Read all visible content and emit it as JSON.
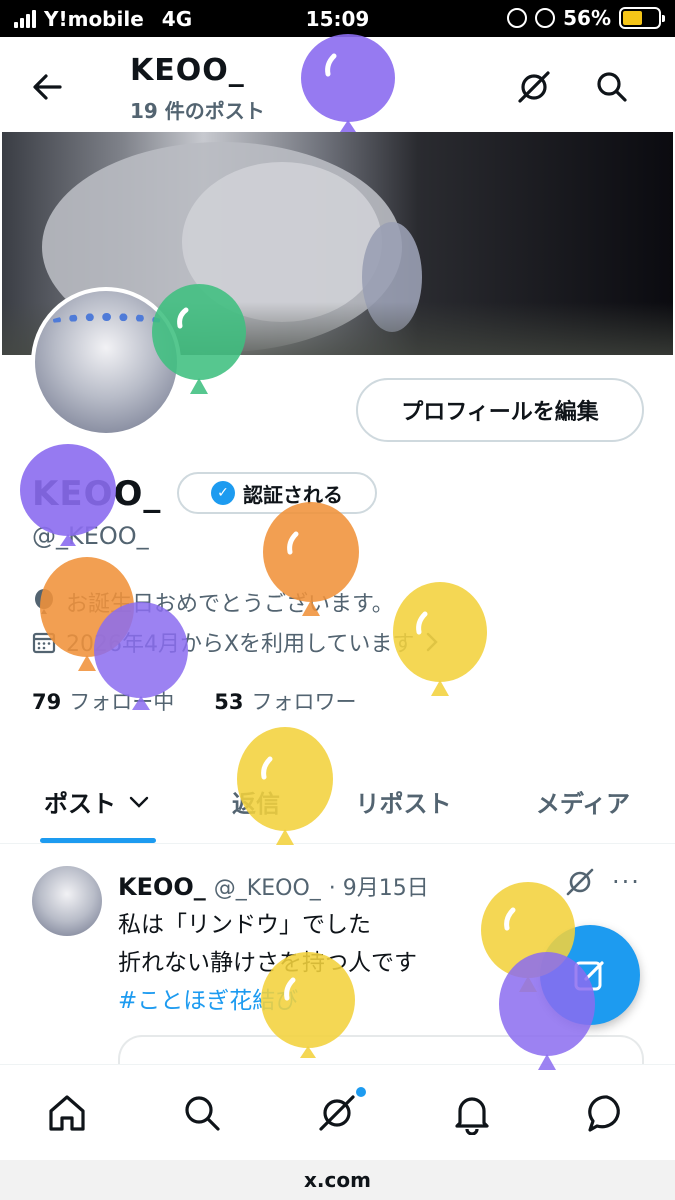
{
  "status_bar": {
    "carrier": "Y!mobile",
    "network": "4G",
    "time": "15:09",
    "battery": "56%",
    "battery_level": 0.56
  },
  "header": {
    "name": "KEOO_",
    "post_count": "19 件のポスト",
    "back_icon": "arrow-left-icon",
    "grok_icon": "grok-icon",
    "search_icon": "search-icon"
  },
  "profile": {
    "edit_button": "プロフィールを編集",
    "name": "KEOO_",
    "verify_button": "認証される",
    "handle": "@_KEOO_",
    "birthday_text": "お誕生日おめでとうございます。",
    "joined_text": "2026年4月からXを利用しています",
    "following_count": "79",
    "following_label": "フォロー中",
    "followers_count": "53",
    "followers_label": "フォロワー"
  },
  "tabs": [
    {
      "label": "ポスト"
    },
    {
      "label": "返信"
    },
    {
      "label": "リポスト"
    },
    {
      "label": "メディア"
    }
  ],
  "post": {
    "name": "KEOO_",
    "handle": "@_KEOO_",
    "date": "· 9月15日",
    "line1": "私は「リンドウ」でした",
    "line2": "折れない静けさを持つ人です",
    "hashtag": "#ことほぎ花結び",
    "more": "···"
  },
  "bottom_nav": [
    "home-icon",
    "search-icon",
    "grok-icon",
    "notifications-icon",
    "messages-icon"
  ],
  "url": "x.com",
  "colors": {
    "accent": "#1d9bf0",
    "balloon_purple": "#8b6cf0",
    "balloon_green": "#3fbf7f",
    "balloon_orange": "#f0923a",
    "balloon_yellow": "#f2d23c"
  }
}
